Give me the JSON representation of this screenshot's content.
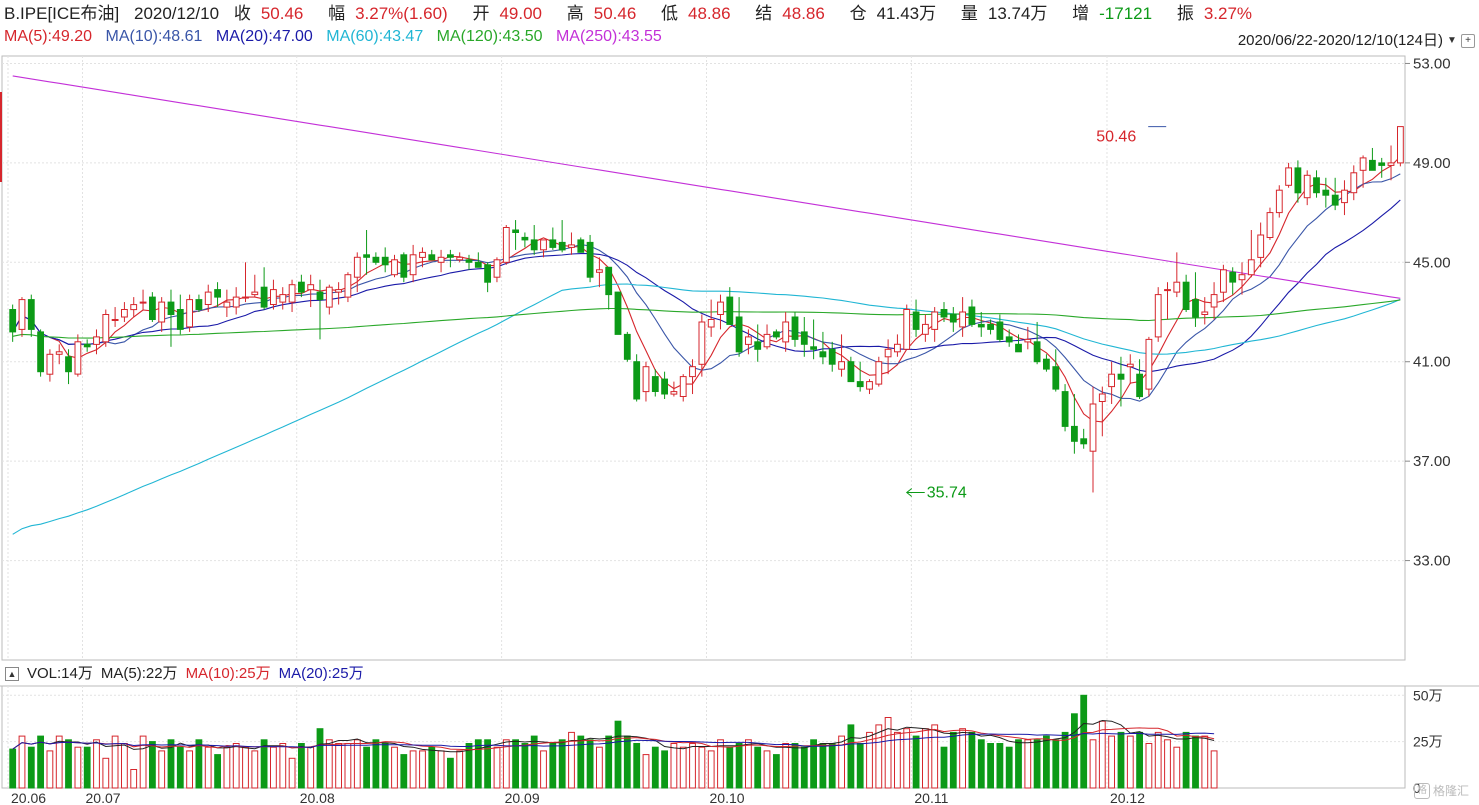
{
  "quote": {
    "symbol": "B.IPE[ICE布油]",
    "date": "2020/12/10",
    "close_label": "收",
    "close": "50.46",
    "change_label": "幅",
    "change": "3.27%(1.60)",
    "open_label": "开",
    "open": "49.00",
    "high_label": "高",
    "high": "50.46",
    "low_label": "低",
    "low": "48.86",
    "settle_label": "结",
    "settle": "48.86",
    "oi_label": "仓",
    "oi": "41.43万",
    "vol_label": "量",
    "vol": "13.74万",
    "oi_chg_label": "增",
    "oi_chg": "-17121",
    "amp_label": "振",
    "amp": "3.27%"
  },
  "ma_legend": [
    {
      "text": "MA(5):49.20",
      "color": "#d6262c"
    },
    {
      "text": "MA(10):48.61",
      "color": "#3a56a8"
    },
    {
      "text": "MA(20):47.00",
      "color": "#1a1aa8"
    },
    {
      "text": "MA(60):43.47",
      "color": "#21b6d4"
    },
    {
      "text": "MA(120):43.50",
      "color": "#2aa82a"
    },
    {
      "text": "MA(250):43.55",
      "color": "#c330d8"
    }
  ],
  "range_text": "2020/06/22-2020/12/10(124日)",
  "vol_legend": [
    {
      "text": "VOL:14万",
      "color": "#222222"
    },
    {
      "text": "MA(5):22万",
      "color": "#222222"
    },
    {
      "text": "MA(10):25万",
      "color": "#d6262c"
    },
    {
      "text": "MA(20):25万",
      "color": "#1a1aa8"
    }
  ],
  "watermark": "格隆汇",
  "chart_data": {
    "type": "candlestick",
    "price_axis": {
      "min": 29.0,
      "max": 53.3,
      "ticks": [
        "53.00",
        "49.00",
        "45.00",
        "41.00",
        "37.00",
        "33.00"
      ]
    },
    "volume_axis": {
      "max_wan": 50,
      "ticks": [
        "50万",
        "25万",
        "0"
      ]
    },
    "x_labels": [
      {
        "text": "20.06",
        "i": 0
      },
      {
        "text": "20.07",
        "i": 8
      },
      {
        "text": "20.08",
        "i": 31
      },
      {
        "text": "20.09",
        "i": 53
      },
      {
        "text": "20.10",
        "i": 75
      },
      {
        "text": "20.11",
        "i": 97
      },
      {
        "text": "20.12",
        "i": 118
      }
    ],
    "annotations": [
      {
        "text": "50.46",
        "i": 123,
        "price": 50.46,
        "side": "left"
      },
      {
        "text": "35.74",
        "i": 96,
        "price": 35.74,
        "side": "right"
      }
    ],
    "ohlc": [
      [
        43.1,
        43.3,
        41.8,
        42.2
      ],
      [
        42.3,
        43.6,
        42.0,
        43.5
      ],
      [
        43.5,
        43.7,
        42.0,
        42.3
      ],
      [
        42.2,
        42.3,
        40.4,
        40.6
      ],
      [
        40.5,
        41.5,
        40.2,
        41.3
      ],
      [
        41.3,
        41.7,
        40.9,
        41.4
      ],
      [
        41.2,
        41.5,
        40.1,
        40.6
      ],
      [
        40.5,
        42.1,
        40.4,
        41.8
      ],
      [
        41.7,
        41.9,
        41.4,
        41.6
      ],
      [
        41.7,
        42.3,
        41.3,
        42.0
      ],
      [
        41.8,
        43.1,
        41.6,
        42.9
      ],
      [
        42.7,
        43.2,
        42.4,
        42.7
      ],
      [
        42.8,
        43.4,
        42.6,
        43.1
      ],
      [
        43.1,
        43.6,
        42.8,
        43.3
      ],
      [
        43.4,
        43.9,
        43.1,
        43.4
      ],
      [
        43.6,
        43.8,
        42.6,
        42.7
      ],
      [
        42.6,
        43.6,
        42.2,
        43.4
      ],
      [
        43.4,
        43.9,
        41.6,
        42.9
      ],
      [
        43.1,
        43.7,
        42.1,
        42.3
      ],
      [
        42.4,
        43.7,
        42.2,
        43.5
      ],
      [
        43.5,
        43.7,
        43.0,
        43.1
      ],
      [
        43.3,
        44.1,
        43.0,
        43.8
      ],
      [
        43.9,
        44.2,
        43.2,
        43.6
      ],
      [
        43.2,
        43.9,
        42.8,
        43.4
      ],
      [
        43.2,
        44.0,
        42.9,
        43.6
      ],
      [
        43.6,
        45.0,
        43.4,
        43.6
      ],
      [
        43.7,
        44.5,
        43.6,
        43.8
      ],
      [
        44.0,
        44.8,
        43.1,
        43.2
      ],
      [
        43.3,
        44.3,
        43.1,
        43.9
      ],
      [
        43.4,
        44.0,
        43.1,
        43.7
      ],
      [
        43.4,
        44.3,
        43.0,
        44.1
      ],
      [
        44.2,
        44.5,
        43.6,
        43.8
      ],
      [
        43.9,
        44.5,
        43.2,
        44.1
      ],
      [
        43.8,
        44.3,
        41.9,
        43.5
      ],
      [
        43.2,
        44.1,
        42.9,
        44.0
      ],
      [
        43.8,
        44.2,
        43.3,
        43.9
      ],
      [
        43.6,
        44.6,
        43.4,
        44.5
      ],
      [
        44.4,
        45.4,
        43.8,
        45.2
      ],
      [
        45.3,
        46.3,
        44.5,
        45.2
      ],
      [
        45.2,
        45.4,
        44.9,
        45.0
      ],
      [
        45.2,
        45.6,
        44.6,
        44.9
      ],
      [
        44.5,
        45.3,
        44.4,
        45.1
      ],
      [
        45.3,
        45.4,
        44.2,
        44.4
      ],
      [
        44.5,
        45.7,
        44.2,
        45.3
      ],
      [
        45.2,
        45.6,
        44.8,
        45.4
      ],
      [
        45.3,
        45.5,
        45.1,
        45.1
      ],
      [
        45.0,
        45.5,
        44.6,
        45.2
      ],
      [
        45.3,
        45.5,
        44.8,
        45.2
      ],
      [
        45.1,
        45.4,
        45.0,
        45.2
      ],
      [
        45.1,
        45.3,
        44.7,
        45.0
      ],
      [
        45.0,
        45.4,
        44.8,
        44.8
      ],
      [
        44.9,
        45.0,
        43.8,
        44.2
      ],
      [
        44.4,
        45.2,
        44.2,
        45.1
      ],
      [
        45.0,
        46.5,
        44.9,
        46.4
      ],
      [
        46.3,
        46.7,
        45.5,
        46.2
      ],
      [
        46.0,
        46.2,
        45.6,
        45.9
      ],
      [
        45.9,
        46.5,
        45.3,
        45.5
      ],
      [
        45.5,
        45.9,
        45.2,
        45.9
      ],
      [
        45.9,
        46.4,
        45.5,
        45.6
      ],
      [
        45.8,
        46.7,
        45.4,
        45.5
      ],
      [
        45.6,
        46.2,
        45.3,
        45.7
      ],
      [
        45.9,
        46.0,
        45.4,
        45.4
      ],
      [
        45.8,
        46.1,
        44.2,
        44.4
      ],
      [
        44.6,
        45.2,
        44.0,
        44.7
      ],
      [
        44.8,
        44.8,
        43.1,
        43.7
      ],
      [
        43.8,
        43.8,
        42.1,
        42.1
      ],
      [
        42.1,
        42.2,
        41.0,
        41.1
      ],
      [
        41.0,
        41.3,
        39.4,
        39.5
      ],
      [
        39.8,
        41.0,
        39.4,
        40.8
      ],
      [
        40.4,
        40.7,
        39.6,
        39.8
      ],
      [
        40.3,
        40.6,
        39.5,
        39.7
      ],
      [
        39.7,
        40.2,
        39.6,
        39.8
      ],
      [
        39.6,
        40.5,
        39.4,
        40.4
      ],
      [
        40.4,
        41.1,
        39.7,
        40.8
      ],
      [
        40.9,
        42.9,
        40.4,
        42.6
      ],
      [
        42.4,
        43.5,
        42.0,
        42.7
      ],
      [
        42.9,
        43.7,
        42.3,
        43.4
      ],
      [
        43.6,
        44.0,
        42.5,
        42.5
      ],
      [
        42.8,
        43.6,
        41.2,
        41.4
      ],
      [
        41.7,
        42.3,
        41.3,
        42.0
      ],
      [
        41.8,
        42.5,
        41.0,
        41.5
      ],
      [
        41.6,
        42.5,
        41.5,
        42.1
      ],
      [
        42.2,
        42.3,
        41.9,
        42.0
      ],
      [
        41.8,
        43.0,
        41.4,
        42.6
      ],
      [
        42.8,
        43.0,
        41.6,
        41.9
      ],
      [
        42.2,
        42.8,
        41.2,
        41.7
      ],
      [
        41.6,
        42.7,
        41.1,
        41.5
      ],
      [
        41.4,
        42.2,
        40.9,
        41.2
      ],
      [
        41.5,
        41.8,
        40.6,
        40.9
      ],
      [
        40.7,
        42.1,
        40.4,
        41.0
      ],
      [
        41.0,
        41.2,
        40.2,
        40.2
      ],
      [
        40.2,
        41.0,
        39.8,
        40.0
      ],
      [
        39.9,
        40.3,
        39.7,
        40.2
      ],
      [
        40.1,
        41.2,
        40.0,
        41.0
      ],
      [
        41.2,
        41.9,
        40.5,
        41.5
      ],
      [
        41.4,
        42.1,
        41.2,
        41.7
      ],
      [
        41.5,
        43.3,
        41.5,
        43.1
      ],
      [
        43.0,
        43.5,
        42.0,
        42.3
      ],
      [
        42.1,
        42.9,
        41.8,
        42.5
      ],
      [
        42.3,
        43.2,
        41.8,
        43.0
      ],
      [
        43.1,
        43.4,
        42.6,
        42.8
      ],
      [
        42.9,
        43.2,
        42.2,
        42.6
      ],
      [
        42.4,
        43.6,
        42.0,
        43.0
      ],
      [
        43.2,
        43.5,
        42.4,
        42.5
      ],
      [
        42.5,
        43.0,
        42.0,
        42.4
      ],
      [
        42.5,
        42.7,
        42.1,
        42.3
      ],
      [
        42.6,
        42.9,
        41.8,
        41.9
      ],
      [
        42.0,
        42.3,
        41.6,
        41.8
      ],
      [
        41.7,
        42.1,
        41.4,
        41.4
      ],
      [
        41.8,
        42.4,
        41.5,
        41.9
      ],
      [
        41.8,
        42.6,
        40.9,
        41.0
      ],
      [
        41.1,
        41.3,
        40.6,
        40.7
      ],
      [
        40.8,
        41.5,
        39.8,
        39.9
      ],
      [
        39.8,
        40.1,
        38.2,
        38.4
      ],
      [
        38.4,
        39.7,
        37.3,
        37.8
      ],
      [
        37.9,
        38.3,
        37.5,
        37.7
      ],
      [
        37.4,
        40.0,
        35.74,
        39.3
      ],
      [
        39.4,
        40.0,
        38.0,
        39.7
      ],
      [
        40.0,
        41.0,
        39.3,
        40.5
      ],
      [
        40.5,
        41.2,
        39.2,
        40.3
      ],
      [
        40.8,
        41.3,
        40.1,
        40.9
      ],
      [
        40.5,
        41.1,
        39.5,
        39.6
      ],
      [
        39.9,
        42.0,
        39.6,
        41.9
      ],
      [
        42.0,
        44.0,
        41.8,
        43.7
      ],
      [
        43.9,
        44.2,
        42.7,
        43.9
      ],
      [
        43.8,
        45.4,
        43.6,
        44.2
      ],
      [
        44.2,
        44.5,
        43.0,
        43.1
      ],
      [
        43.5,
        44.6,
        42.4,
        42.8
      ],
      [
        42.9,
        43.6,
        42.5,
        43.0
      ],
      [
        43.2,
        44.2,
        42.7,
        43.7
      ],
      [
        43.8,
        44.9,
        43.4,
        44.7
      ],
      [
        44.6,
        44.8,
        43.7,
        44.2
      ],
      [
        44.3,
        45.0,
        43.7,
        44.5
      ],
      [
        44.5,
        46.3,
        44.4,
        45.1
      ],
      [
        45.2,
        46.6,
        44.8,
        46.1
      ],
      [
        46.0,
        47.2,
        45.9,
        47.0
      ],
      [
        47.0,
        48.1,
        46.8,
        47.9
      ],
      [
        48.1,
        49.0,
        48.0,
        48.8
      ],
      [
        48.8,
        49.1,
        47.4,
        47.8
      ],
      [
        47.6,
        48.7,
        47.3,
        48.5
      ],
      [
        48.4,
        48.7,
        47.6,
        47.8
      ],
      [
        47.9,
        48.4,
        47.2,
        47.7
      ],
      [
        47.7,
        48.4,
        47.1,
        47.3
      ],
      [
        47.4,
        48.3,
        46.9,
        47.9
      ],
      [
        47.8,
        48.9,
        47.5,
        48.6
      ],
      [
        48.7,
        49.3,
        48.0,
        49.2
      ],
      [
        49.1,
        49.6,
        48.7,
        48.7
      ],
      [
        49.0,
        49.2,
        48.4,
        48.9
      ],
      [
        48.9,
        49.7,
        48.3,
        49.0
      ],
      [
        49.0,
        50.46,
        48.86,
        50.46
      ]
    ],
    "volume_wan": [
      21,
      28,
      22,
      28,
      20,
      28,
      26,
      22,
      22,
      26,
      16,
      28,
      24,
      10,
      28,
      25,
      20,
      26,
      22,
      20,
      26,
      22,
      18,
      22,
      24,
      22,
      20,
      26,
      22,
      24,
      16,
      24,
      22,
      32,
      26,
      24,
      24,
      26,
      22,
      26,
      24,
      22,
      18,
      20,
      20,
      22,
      20,
      16,
      20,
      24,
      26,
      26,
      22,
      26,
      26,
      24,
      28,
      20,
      24,
      26,
      30,
      28,
      26,
      22,
      28,
      36,
      28,
      24,
      18,
      22,
      20,
      24,
      22,
      24,
      22,
      20,
      26,
      22,
      24,
      26,
      22,
      20,
      18,
      24,
      24,
      22,
      26,
      24,
      24,
      28,
      34,
      24,
      30,
      34,
      38,
      30,
      32,
      28,
      32,
      34,
      22,
      30,
      32,
      30,
      26,
      24,
      24,
      22,
      26,
      26,
      26,
      28,
      26,
      30,
      40,
      50,
      26,
      36,
      28,
      30,
      28,
      30,
      24,
      30,
      26,
      22,
      30,
      28,
      28,
      20
    ]
  }
}
